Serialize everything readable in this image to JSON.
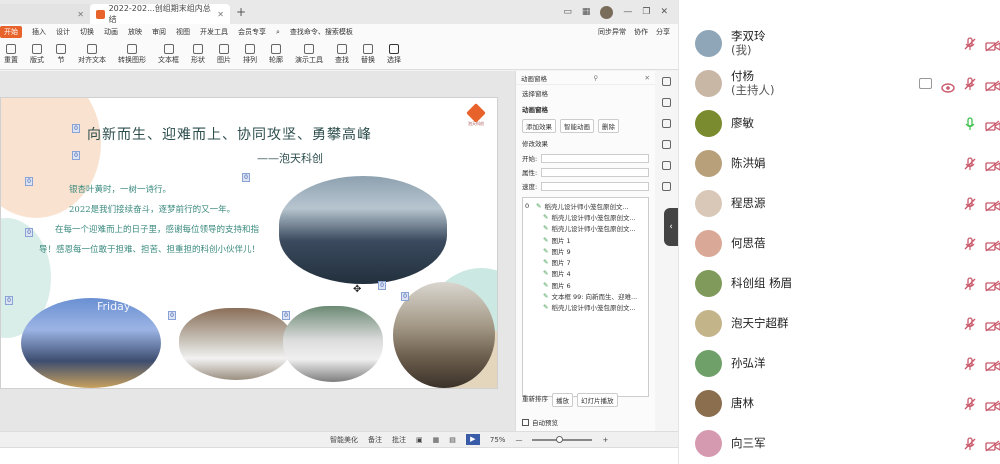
{
  "window": {
    "tabs": [
      {
        "label": "",
        "active": false
      },
      {
        "label": "2022-202...创组期末组内总结",
        "active": true
      }
    ],
    "add_tab": "+",
    "sign_in": "日"
  },
  "menu": {
    "start": "开始",
    "items": [
      "插入",
      "设计",
      "切换",
      "动画",
      "放映",
      "审阅",
      "视图",
      "开发工具",
      "会员专享"
    ],
    "search": "查找命令、搜索模板",
    "right": [
      "同步异常",
      "协作",
      "分享"
    ]
  },
  "ribbon": {
    "buttons": [
      "文本框",
      "形状",
      "图片",
      "排列",
      "轮廓",
      "演示工具",
      "查找",
      "替换",
      "选择"
    ],
    "small": [
      "重置",
      "节",
      "版式",
      "对齐文本",
      "转换图形"
    ]
  },
  "slide": {
    "title": "向新而生、迎难而上、协同攻坚、勇攀高峰",
    "signature": "——泡天科创",
    "paragraphs": [
      "银杏叶黄时，一树一诗行。",
      "2022是我们接续奋斗，逐梦前行的又一年。",
      "在每一个迎难而上的日子里，感谢每位领导的支持和指导！感恩每一位敢于担难、担苦、担重担的科创小伙伴儿！"
    ],
    "logo_text": "泡天科创",
    "photo_caption": "Friday",
    "tag_label": "0"
  },
  "animation_pane": {
    "header": "动画窗格",
    "select_pane": "选择窗格",
    "section": "动画窗格",
    "add_effect": "添加效果",
    "smart_anim": "智能动画",
    "delete": "删除",
    "modify": "修改效果",
    "start_label": "开始:",
    "prop_label": "属性:",
    "speed_label": "速度:",
    "list": [
      {
        "idx": "0",
        "text": "稻壳儿设计师小笼包原创文...",
        "sub": false
      },
      {
        "idx": "",
        "text": "稻壳儿设计师小笼包原创文...",
        "sub": true
      },
      {
        "idx": "",
        "text": "稻壳儿设计师小笼包原创文...",
        "sub": true
      },
      {
        "idx": "",
        "text": "图片 1",
        "sub": true
      },
      {
        "idx": "",
        "text": "图片 9",
        "sub": true
      },
      {
        "idx": "",
        "text": "图片 7",
        "sub": true
      },
      {
        "idx": "",
        "text": "图片 4",
        "sub": true
      },
      {
        "idx": "",
        "text": "图片 6",
        "sub": true
      },
      {
        "idx": "",
        "text": "文本框 99: 向新而生、迎难...",
        "sub": true
      },
      {
        "idx": "",
        "text": "稻壳儿设计师小笼包原创文...",
        "sub": true
      }
    ],
    "reorder": "重新排序",
    "play": "播放",
    "slideshow": "幻灯片播放",
    "auto_preview": "自动预览"
  },
  "status": {
    "smart_beautify": "智能美化",
    "notes": "备注",
    "comments": "批注",
    "zoom": "75%"
  },
  "participants": [
    {
      "name": "李双玲",
      "sub": "(我)",
      "color": "#8fa6b8"
    },
    {
      "name": "付杨",
      "sub": "(主持人)",
      "color": "#c9b7a6"
    },
    {
      "name": "廖敏",
      "sub": "",
      "color": "#7a8a2e"
    },
    {
      "name": "陈洪娟",
      "sub": "",
      "color": "#b8a07a"
    },
    {
      "name": "程思源",
      "sub": "",
      "color": "#d9c8b7"
    },
    {
      "name": "何思蓓",
      "sub": "",
      "color": "#d9a896"
    },
    {
      "name": "科创组 杨眉",
      "sub": "",
      "color": "#7f9a5a"
    },
    {
      "name": "泡天宁超群",
      "sub": "",
      "color": "#c4b48a"
    },
    {
      "name": "孙弘洋",
      "sub": "",
      "color": "#6fa06a"
    },
    {
      "name": "唐林",
      "sub": "",
      "color": "#8a6e4e"
    },
    {
      "name": "向三军",
      "sub": "",
      "color": "#d59ab0"
    }
  ],
  "colors": {
    "accent": "#e8632b",
    "muted": "#c9586a",
    "live_mic": "#3cc04a",
    "slide_text": "#3a8a7e"
  }
}
